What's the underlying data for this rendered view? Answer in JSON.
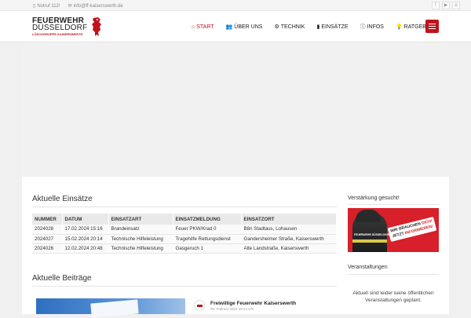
{
  "topbar": {
    "phone_text": "Notruf 112!",
    "email_text": "info@ff-kaiserswerth.de",
    "social_icons": [
      "facebook-icon",
      "youtube-icon",
      "instagram-icon"
    ]
  },
  "logo": {
    "line1": "FEUERWEHR",
    "line2": "DÜSSELDORF",
    "line3": "LÖSCHGRUPPE KAISERSWERTH"
  },
  "nav": {
    "items": [
      {
        "label": "START",
        "icon": "home-icon",
        "active": true
      },
      {
        "label": "ÜBER UNS",
        "icon": "users-icon",
        "active": false
      },
      {
        "label": "TECHNIK",
        "icon": "gears-icon",
        "active": false
      },
      {
        "label": "EINSÄTZE",
        "icon": "extinguisher-icon",
        "active": false
      },
      {
        "label": "INFOS",
        "icon": "info-icon",
        "active": false
      },
      {
        "label": "RATGEBER",
        "icon": "lightbulb-icon",
        "active": false
      }
    ],
    "menu_icon": "hamburger-icon"
  },
  "main": {
    "einsaetze_title": "Aktuelle Einsätze",
    "table": {
      "headers": [
        "NUMMER",
        "DATUM",
        "EINSATZART",
        "EINSATZMELDUNG",
        "EINSATZORT"
      ],
      "rows": [
        [
          "2024028",
          "17.02.2024 15:16",
          "Brandeinsatz",
          "Feuer PKW/Krad 0",
          "B8n Stadtaus, Lohausen"
        ],
        [
          "2024027",
          "15.02.2024 20:14",
          "Technische Hilfeleistung",
          "Tragehilfe Rettungsdienst",
          "Gandersheimer Straße, Kaiserswerth"
        ],
        [
          "2024026",
          "12.02.2024 20:48",
          "Technische Hilfeleistung",
          "Gasgeruch 1",
          "Alte Landstraße, Kaiserswerth"
        ]
      ]
    },
    "beitraege_title": "Aktuelle Beiträge",
    "post": {
      "author": "Freiwillige Feuerwehr Kaiserswerth",
      "date": "06. Februar 2024 19:24 Uhr"
    }
  },
  "sidebar": {
    "recruit_title": "Verstärkung gesucht!",
    "recruit_badge_line1": "WIR BRAUCHEN",
    "recruit_badge_emph": "DICH!",
    "recruit_badge_line2": "JETZT",
    "recruit_badge_line2_emph": "INFORMIEREN!",
    "recruit_jacket_text": "FEUERWEHR DÜSSELDORF",
    "events_title": "Veranstaltungen",
    "events_text": "Aktuell sind leider keine öffentlichen Veranstaltungen geplant."
  },
  "colors": {
    "brand_red": "#c0131b",
    "promo_red": "#d8202a"
  }
}
